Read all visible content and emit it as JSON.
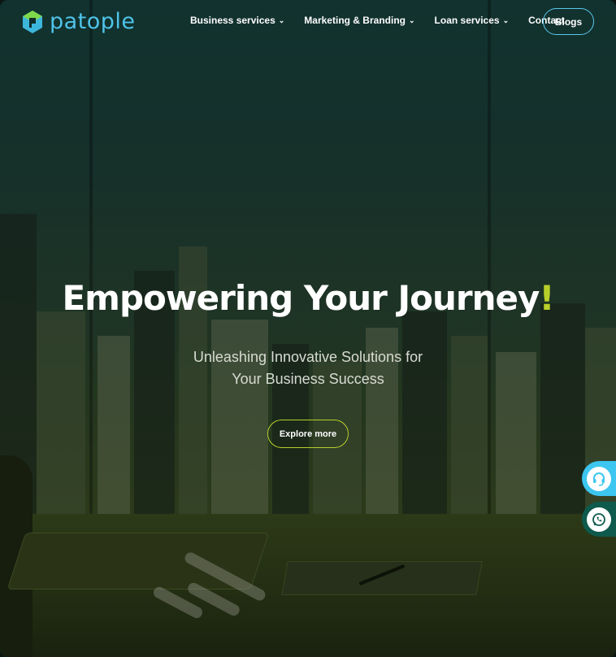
{
  "brand": {
    "name": "patople",
    "logo_icon": "patople-logo-icon"
  },
  "nav": {
    "items": [
      {
        "label": "Business services",
        "has_dropdown": true
      },
      {
        "label": "Marketing & Branding",
        "has_dropdown": true
      },
      {
        "label": "Loan services",
        "has_dropdown": true
      },
      {
        "label": "Contact",
        "has_dropdown": false
      }
    ],
    "cta_label": "Blogs"
  },
  "hero": {
    "headline": "Empowering Your Journey",
    "headline_accent": "!",
    "subheadline_line1": "Unleashing Innovative Solutions for",
    "subheadline_line2": "Your Business Success",
    "button_label": "Explore more"
  },
  "floating": {
    "support_icon": "headset-support-icon",
    "whatsapp_icon": "whatsapp-icon"
  },
  "colors": {
    "brand_blue": "#4fc3e8",
    "accent_lime": "#b8cf2a",
    "whatsapp_green": "#0e5a4c"
  }
}
